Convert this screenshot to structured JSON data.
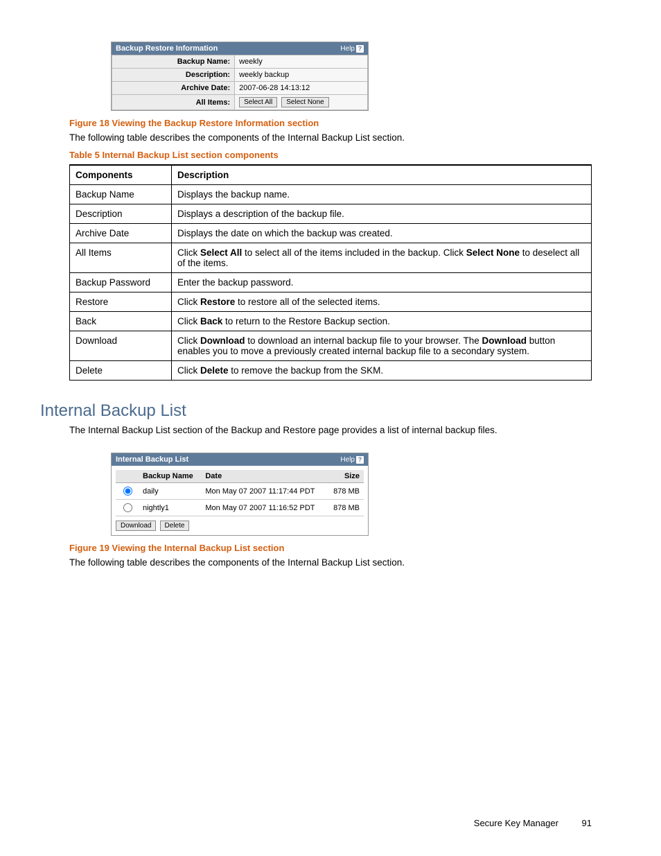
{
  "figure18": {
    "panel_title": "Backup Restore Information",
    "help_label": "Help",
    "rows": {
      "backup_name_label": "Backup Name:",
      "backup_name_value": "weekly",
      "description_label": "Description:",
      "description_value": "weekly backup",
      "archive_date_label": "Archive Date:",
      "archive_date_value": "2007-06-28 14:13:12",
      "all_items_label": "All Items:"
    },
    "buttons": {
      "select_all": "Select All",
      "select_none": "Select None"
    },
    "caption": "Figure 18 Viewing the Backup Restore Information section"
  },
  "intro_para_1": "The following table describes the components of the Internal Backup List section.",
  "table5": {
    "caption": "Table 5 Internal Backup List section components",
    "head_components": "Components",
    "head_description": "Description",
    "rows": [
      {
        "c": "Backup Name",
        "d_plain": "Displays the backup name."
      },
      {
        "c": "Description",
        "d_plain": "Displays a description of the backup file."
      },
      {
        "c": "Archive Date",
        "d_plain": "Displays the date on which the backup was created."
      },
      {
        "c": "All Items",
        "d_parts": [
          "Click ",
          "Select All",
          " to select all of the items included in the backup. Click ",
          "Select None",
          " to deselect all of the items."
        ]
      },
      {
        "c": "Backup Password",
        "d_plain": "Enter the backup password."
      },
      {
        "c": "Restore",
        "d_parts": [
          "Click ",
          "Restore",
          " to restore all of the selected items."
        ]
      },
      {
        "c": "Back",
        "d_parts": [
          "Click ",
          "Back",
          " to return to the Restore Backup section."
        ]
      },
      {
        "c": "Download",
        "d_parts": [
          "Click ",
          "Download",
          " to download an internal backup file to your browser. The ",
          "Download",
          " button enables you to move a previously created internal backup file to a secondary system."
        ]
      },
      {
        "c": "Delete",
        "d_parts": [
          "Click ",
          "Delete",
          " to remove the backup from the SKM."
        ]
      }
    ]
  },
  "section_heading": "Internal Backup List",
  "section_para": "The Internal Backup List section of the Backup and Restore page provides a list of internal backup files.",
  "figure19": {
    "panel_title": "Internal Backup List",
    "help_label": "Help",
    "columns": {
      "name": "Backup Name",
      "date": "Date",
      "size": "Size"
    },
    "rows": [
      {
        "selected": true,
        "name": "daily",
        "date": "Mon May 07 2007 11:17:44 PDT",
        "size": "878 MB"
      },
      {
        "selected": false,
        "name": "nightly1",
        "date": "Mon May 07 2007 11:16:52 PDT",
        "size": "878 MB"
      }
    ],
    "buttons": {
      "download": "Download",
      "delete": "Delete"
    },
    "caption": "Figure 19 Viewing the Internal Backup List section"
  },
  "intro_para_2": "The following table describes the components of the Internal Backup List section.",
  "footer": {
    "title": "Secure Key Manager",
    "page": "91"
  }
}
